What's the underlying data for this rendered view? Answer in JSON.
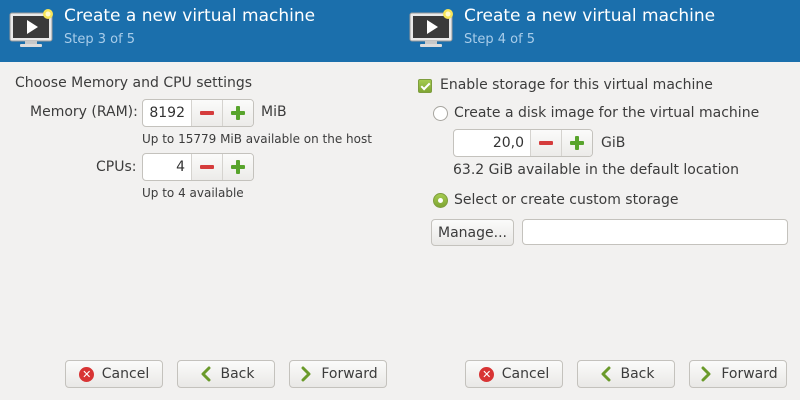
{
  "icons": {
    "vm_icon": "monitor-play-icon",
    "cancel": "cancel-icon",
    "back": "back-chevron-icon",
    "forward": "forward-chevron-icon",
    "minus": "minus-icon",
    "plus": "plus-icon"
  },
  "left": {
    "header": {
      "title": "Create a new virtual machine",
      "step": "Step 3 of 5"
    },
    "section_title": "Choose Memory and CPU settings",
    "memory": {
      "label": "Memory (RAM):",
      "value": "8192",
      "unit": "MiB",
      "hint": "Up to 15779 MiB available on the host"
    },
    "cpus": {
      "label": "CPUs:",
      "value": "4",
      "hint": "Up to 4 available"
    },
    "buttons": {
      "cancel": "Cancel",
      "back": "Back",
      "forward": "Forward"
    }
  },
  "right": {
    "header": {
      "title": "Create a new virtual machine",
      "step": "Step 4 of 5"
    },
    "enable_storage": {
      "label": "Enable storage for this virtual machine",
      "checked": true
    },
    "disk_image": {
      "label": "Create a disk image for the virtual machine",
      "selected": false,
      "value": "20,0",
      "unit": "GiB",
      "available": "63.2 GiB available in the default location"
    },
    "custom_storage": {
      "label": "Select or create custom storage",
      "selected": true,
      "manage_label": "Manage...",
      "path_value": ""
    },
    "buttons": {
      "cancel": "Cancel",
      "back": "Back",
      "forward": "Forward"
    }
  },
  "colors": {
    "header_bg": "#1b6fac",
    "header_step": "#a9cdea",
    "window_bg": "#f2f1f0",
    "accent_green": "#7fa533",
    "minus_red": "#d53c3c",
    "plus_green": "#58a42c"
  }
}
